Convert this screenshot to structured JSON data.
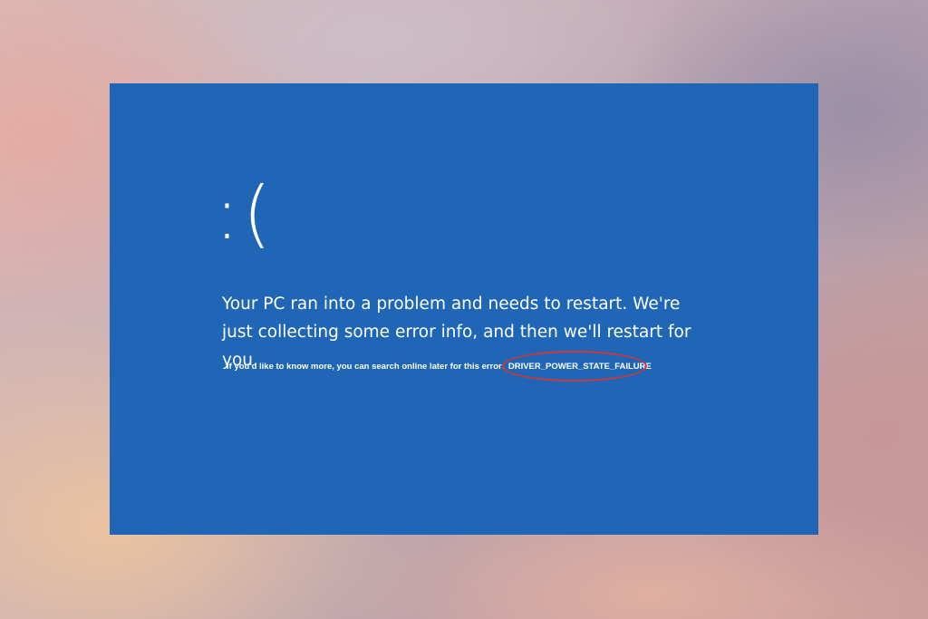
{
  "screen": {
    "background_color": "#1f67b6",
    "text_color": "#ffffff",
    "sad_face": ":(",
    "headline": "Your PC ran into a problem and needs to restart. We're just collecting some error info, and then we'll restart for you.",
    "more_info_prefix": "If you'd like to know more, you can search online later for this error:",
    "stop_code": "DRIVER_POWER_STATE_FAILURE"
  },
  "annotation": {
    "highlight_color": "#d0353a",
    "highlighted_item": "stop_code"
  }
}
